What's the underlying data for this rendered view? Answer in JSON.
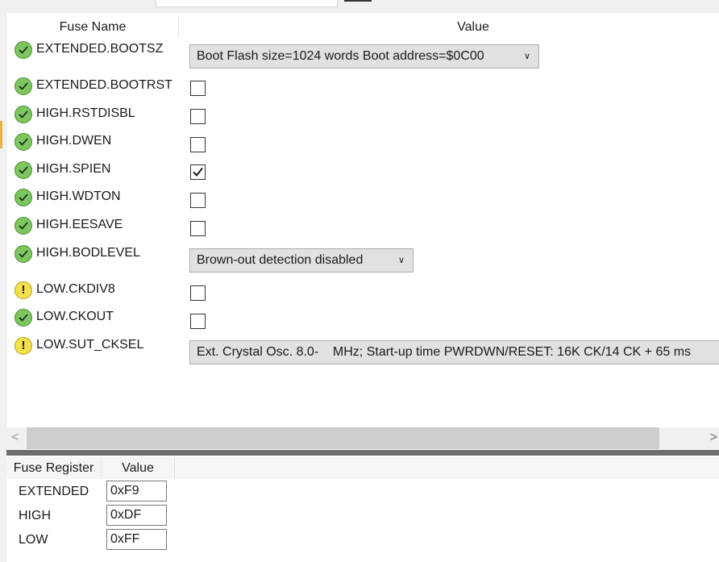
{
  "fuse_table": {
    "header_name": "Fuse Name",
    "header_value": "Value",
    "rows": [
      {
        "name": "EXTENDED.BOOTSZ",
        "status": "ok",
        "type": "select",
        "value": "Boot Flash size=1024 words Boot address=$0C00"
      },
      {
        "name": "EXTENDED.BOOTRST",
        "status": "ok",
        "type": "checkbox",
        "checked": false
      },
      {
        "name": "HIGH.RSTDISBL",
        "status": "ok",
        "type": "checkbox",
        "checked": false
      },
      {
        "name": "HIGH.DWEN",
        "status": "ok",
        "type": "checkbox",
        "checked": false
      },
      {
        "name": "HIGH.SPIEN",
        "status": "ok",
        "type": "checkbox",
        "checked": true
      },
      {
        "name": "HIGH.WDTON",
        "status": "ok",
        "type": "checkbox",
        "checked": false
      },
      {
        "name": "HIGH.EESAVE",
        "status": "ok",
        "type": "checkbox",
        "checked": false
      },
      {
        "name": "HIGH.BODLEVEL",
        "status": "ok",
        "type": "select",
        "value": "Brown-out detection disabled"
      },
      {
        "name": "LOW.CKDIV8",
        "status": "warning",
        "type": "checkbox",
        "checked": false
      },
      {
        "name": "LOW.CKOUT",
        "status": "ok",
        "type": "checkbox",
        "checked": false
      },
      {
        "name": "LOW.SUT_CKSEL",
        "status": "warning",
        "type": "select",
        "value": "Ext. Crystal Osc. 8.0-    MHz; Start-up time PWRDWN/RESET: 16K CK/14 CK + 65 ms"
      }
    ]
  },
  "icons": {
    "ok": "check-circle-icon",
    "warning": "exclamation-circle-icon",
    "dropdown": "chevron-down-icon"
  },
  "colors": {
    "ok": "#7bc75e",
    "warning": "#f4e04a"
  },
  "scrollbar": {
    "left_arrow": "<",
    "right_arrow": ">"
  },
  "register_table": {
    "header_register": "Fuse Register",
    "header_value": "Value",
    "rows": [
      {
        "register": "EXTENDED",
        "value": "0xF9"
      },
      {
        "register": "HIGH",
        "value": "0xDF"
      },
      {
        "register": "LOW",
        "value": "0xFF"
      }
    ]
  }
}
